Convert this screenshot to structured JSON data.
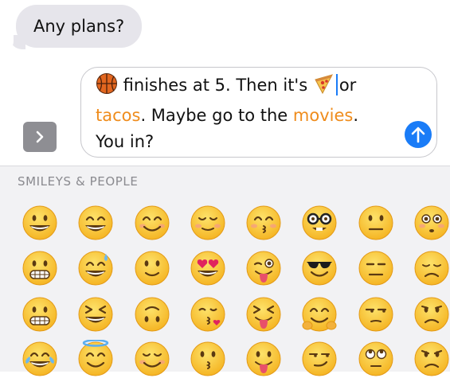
{
  "conversation": {
    "incoming_message": "Any plans?"
  },
  "compose": {
    "segments": [
      {
        "type": "emoji",
        "name": "basketball-emoji"
      },
      {
        "type": "text",
        "text": " finishes at 5. Then it's "
      },
      {
        "type": "emoji",
        "name": "pizza-emoji"
      },
      {
        "type": "cursor"
      },
      {
        "type": "text",
        "text": "or"
      },
      {
        "type": "break"
      },
      {
        "type": "keyword",
        "text": "tacos"
      },
      {
        "type": "text",
        "text": ". Maybe go to the "
      },
      {
        "type": "keyword",
        "text": "movies"
      },
      {
        "type": "text",
        "text": "."
      },
      {
        "type": "break"
      },
      {
        "type": "text",
        "text": "You in?"
      }
    ],
    "keyword_color": "#ef8c1c",
    "send_icon": "arrow-up-icon"
  },
  "apps_button": {
    "icon": "chevron-right-icon"
  },
  "keyboard": {
    "category": "SMILEYS & PEOPLE",
    "emoji_rows": [
      [
        "grinning-face",
        "grinning-face-smiling-eyes",
        "smiling-face-smiling-eyes",
        "relieved-face",
        "kissing-face-smiling-eyes",
        "nerd-face",
        "neutral-face",
        "flushed-face"
      ],
      [
        "grimacing-face",
        "grinning-face-sweat",
        "slightly-smiling-face",
        "heart-eyes-face",
        "winking-tongue-face",
        "sunglasses-face",
        "expressionless-face",
        "disappointed-face"
      ],
      [
        "grimacing-face",
        "squinting-grin-face",
        "upside-down-face",
        "blowing-kiss-face",
        "squinting-tongue-face",
        "hugging-face",
        "unamused-face",
        "worried-face"
      ],
      [
        "tears-of-joy-face",
        "smiling-face-halo",
        "smiling-face-blush",
        "kissing-face",
        "tongue-out-face",
        "smirking-face",
        "eye-roll-face",
        "pouting-face"
      ]
    ]
  },
  "colors": {
    "accent_blue": "#1a7cf7",
    "incoming_bubble": "#e6e5eb",
    "keyboard_bg": "#f2f2f4",
    "emoji_yellow": "#fbc93d"
  }
}
